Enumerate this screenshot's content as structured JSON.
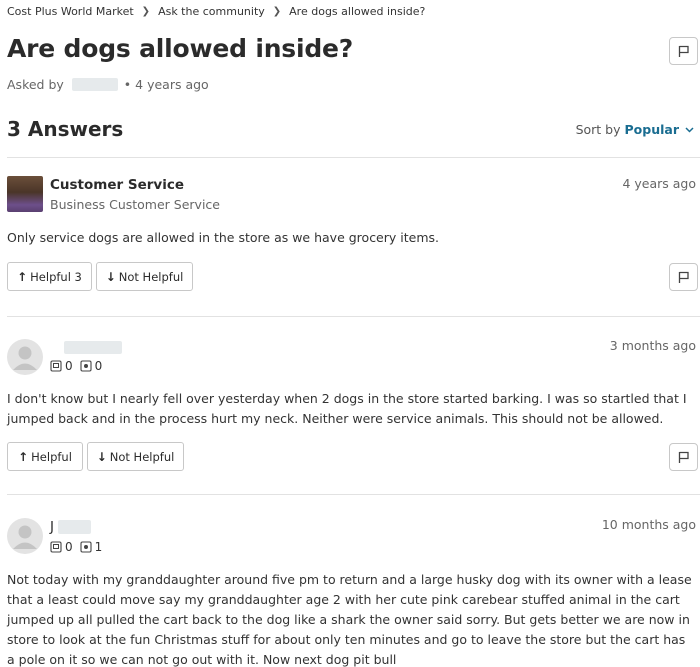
{
  "breadcrumb": {
    "items": [
      "Cost Plus World Market",
      "Ask the community",
      "Are dogs allowed inside?"
    ]
  },
  "question": {
    "title": "Are dogs allowed inside?",
    "asked_prefix": "Asked by",
    "asked_time": "• 4 years ago",
    "flag_icon": "flag-icon"
  },
  "answers_header": {
    "count_label": "3 Answers",
    "sort_label": "Sort by",
    "sort_value": "Popular"
  },
  "answers": [
    {
      "author": "Customer Service",
      "subtitle": "Business Customer Service",
      "time": "4 years ago",
      "text": "Only service dogs are allowed in the store as we have grocery items.",
      "helpful_label": "Helpful 3",
      "not_helpful_label": "Not Helpful"
    },
    {
      "author": "",
      "time": "3 months ago",
      "stat_questions": "0",
      "stat_answers": "0",
      "text": "I don't know but I nearly fell over yesterday when 2 dogs in the store started barking. I was so startled that I jumped back and in the process hurt my neck. Neither were service animals. This should not be allowed.",
      "helpful_label": "Helpful",
      "not_helpful_label": "Not Helpful"
    },
    {
      "author": "J",
      "time": "10 months ago",
      "stat_questions": "0",
      "stat_answers": "1",
      "text": "Not today with my granddaughter around five pm to return and a large husky dog with its owner with a lease that a least could move say my granddaughter age 2 with her cute pink carebear stuffed animal in the cart jumped up all pulled the cart back to the dog like a shark the owner said sorry. But gets better we are now in store to look at the fun Christmas stuff for about only ten minutes and go to leave the store but the cart has a pole on it so we can not go out with it. Now next dog pit bull"
    }
  ],
  "colors": {
    "accent": "#1a6d91",
    "text": "#2b2b2b",
    "muted": "#666666",
    "border": "#c8c8c8"
  }
}
